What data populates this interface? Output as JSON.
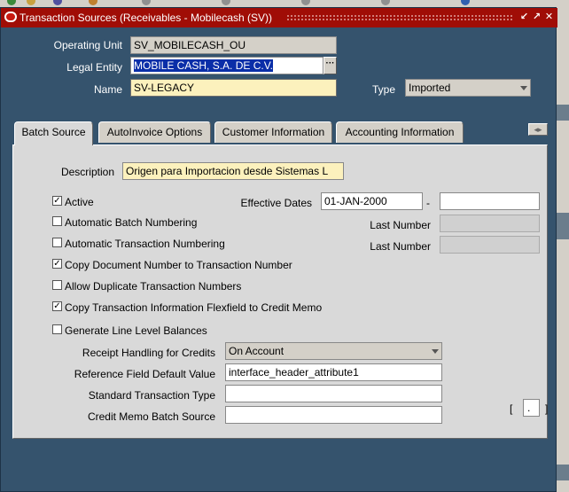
{
  "window": {
    "title": "Transaction Sources (Receivables - Mobilecash (SV))",
    "buttons": [
      "↙",
      "↗",
      "✕"
    ]
  },
  "header": {
    "operating_unit_label": "Operating Unit",
    "operating_unit_value": "SV_MOBILECASH_OU",
    "legal_entity_label": "Legal Entity",
    "legal_entity_value": "MOBILE CASH, S.A. DE C.V.",
    "name_label": "Name",
    "name_value": "SV-LEGACY",
    "type_label": "Type",
    "type_value": "Imported",
    "lov_glyph": "···"
  },
  "tabs": [
    {
      "label": "Batch Source",
      "active": true
    },
    {
      "label": "AutoInvoice Options",
      "active": false
    },
    {
      "label": "Customer Information",
      "active": false
    },
    {
      "label": "Accounting Information",
      "active": false
    }
  ],
  "tab_scroll_glyph": "◂▸",
  "batch_source": {
    "description_label": "Description",
    "description_value": "Origen para Importacion desde Sistemas L",
    "active_label": "Active",
    "active_checked": true,
    "effective_dates_label": "Effective Dates",
    "effective_from": "01-JAN-2000",
    "effective_sep": "-",
    "effective_to": "",
    "auto_batch_label": "Automatic Batch Numbering",
    "auto_batch_checked": false,
    "last_number_label_1": "Last Number",
    "auto_trx_label": "Automatic Transaction Numbering",
    "auto_trx_checked": false,
    "last_number_label_2": "Last Number",
    "copy_doc_label": "Copy Document Number to Transaction Number",
    "copy_doc_checked": true,
    "allow_dup_label": "Allow Duplicate Transaction Numbers",
    "allow_dup_checked": false,
    "copy_flex_label": "Copy Transaction Information Flexfield to Credit Memo",
    "copy_flex_checked": true,
    "gen_line_label": "Generate Line Level Balances",
    "gen_line_checked": false,
    "receipt_handling_label": "Receipt Handling for Credits",
    "receipt_handling_value": "On Account",
    "ref_field_label": "Reference Field Default Value",
    "ref_field_value": "interface_header_attribute1",
    "std_trx_label": "Standard Transaction Type",
    "std_trx_value": "",
    "cm_batch_label": "Credit Memo Batch Source",
    "cm_batch_value": "",
    "flex_open": "[",
    "flex_value": ".",
    "flex_close": "]"
  },
  "colors": {
    "title_bar": "#a00d06",
    "window_bg": "#35536d",
    "panel_bg": "#d9d9d9",
    "required_field": "#fcf1bd",
    "selection": "#0a2ea8"
  }
}
